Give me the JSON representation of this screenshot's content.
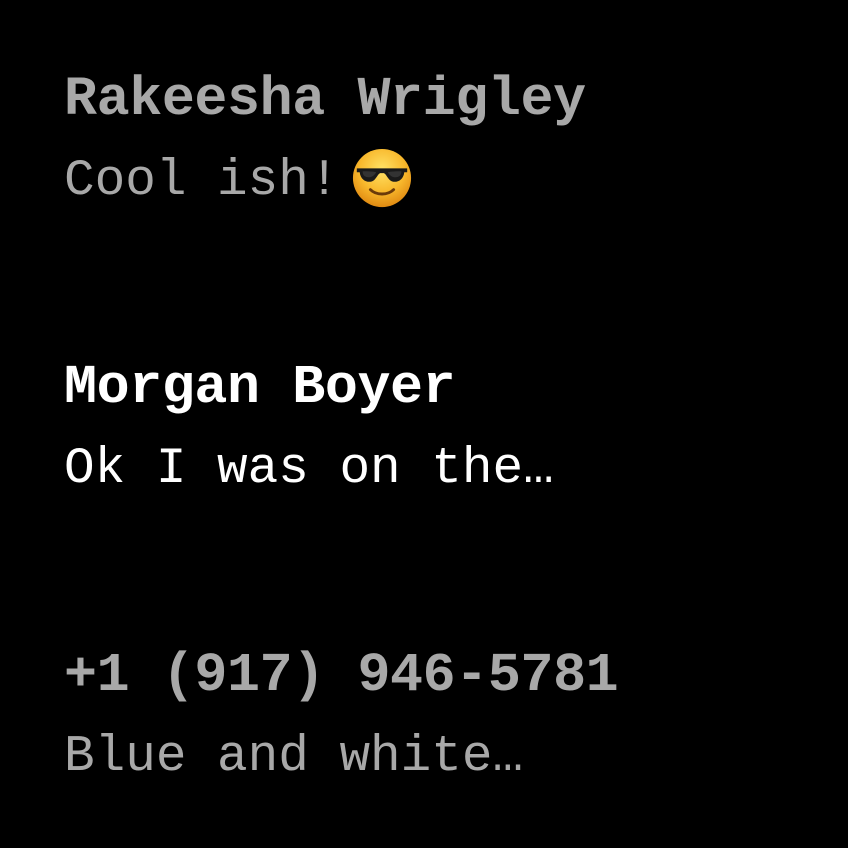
{
  "conversations": [
    {
      "sender": "Rakeesha Wrigley",
      "preview": "Cool ish!",
      "emoji": "smiling-face-with-sunglasses",
      "unread": false
    },
    {
      "sender": "Morgan Boyer",
      "preview": "Ok I was on the…",
      "unread": true
    },
    {
      "sender": "+1 (917) 946-5781",
      "preview": "Blue and white…",
      "unread": false
    }
  ],
  "colors": {
    "background": "#000000",
    "read_text": "#a8a8a8",
    "unread_text": "#ffffff"
  }
}
